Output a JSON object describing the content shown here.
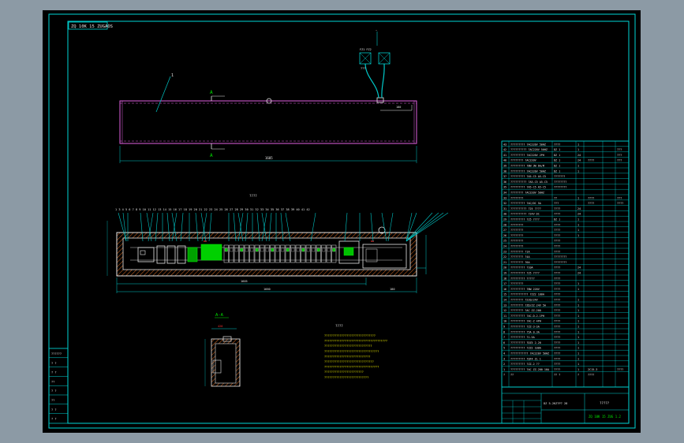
{
  "drawing": {
    "code_box": "ZQ 10K 15 ZUGAOS",
    "balloon_1": "1",
    "section_a_top": "A",
    "section_a_bottom": "A",
    "top_dim": "1605",
    "front_label": "????",
    "front_balloons": "1  3  4   5  6  7  8   9  10 11 12 13 14 15 16   17 18 19 20 21 22 23 24 25 26 27 28 29 30 31   32   33   34   35   36   37 38   39 40 41 42",
    "front_dim_main": "1605",
    "front_dim_total": "1660",
    "front_dim_right": "180",
    "section_title": "A-A",
    "section_dim": "420",
    "notes_title": "????",
    "notes_lines": [
      "??????????????????????????????",
      "?????????????????????????????????????",
      "????????????????????????????",
      "????????????????????????????????",
      "???????????????????????????",
      "?????????????????????????????",
      "????????????????????????????????",
      "???????????????????????",
      "??????????????????????????"
    ],
    "fan_labels": [
      "FZ1 FZ2",
      "???"
    ]
  },
  "left_strip": {
    "rows": [
      "??????",
      "? ?",
      "? ?",
      "??",
      "? ?",
      "??",
      "? ?",
      "? ?"
    ]
  },
  "bom": {
    "rows": [
      [
        "43",
        "????????? ?AC220V 50HZ",
        "????",
        "1",
        "",
        ""
      ],
      [
        "42",
        "?????????? ?AC220V 50HZ",
        "DZ 1",
        "1",
        "",
        "???"
      ],
      [
        "41",
        "????????? ?AC220V 2PH",
        "DZ 1",
        "24",
        "",
        "???"
      ],
      [
        "40",
        "???????? ?AC220V",
        "DZ 1",
        "24",
        "????",
        "???"
      ],
      [
        "39",
        "????????? ?BW 3W 6A/M",
        "DZ 1",
        "1",
        "",
        ""
      ],
      [
        "38",
        "????????? ?AC220V 50HZ",
        "DZ 1",
        "1",
        "",
        ""
      ],
      [
        "37",
        "????????? ?A5-C5 A5-C5",
        "???????",
        "",
        "",
        ""
      ],
      [
        "36",
        "?????????? ?A5-C5 A5-C5",
        "????????",
        "",
        "",
        ""
      ],
      [
        "35",
        "????????? ?A5-C5 A5-C5",
        "????????",
        "",
        "",
        ""
      ],
      [
        "34",
        "???????? ?AC220V 50HZ",
        "",
        "",
        "",
        ""
      ],
      [
        "33",
        "????????",
        "??",
        "1",
        "????",
        "???"
      ],
      [
        "32",
        "????????? ?AC/DC 5A",
        "???",
        "",
        "????",
        "????"
      ],
      [
        "31",
        "?????????? ?25 ????",
        "????",
        "24",
        "",
        ""
      ],
      [
        "30",
        "?????????? ?24V DC",
        "????",
        "24",
        "",
        ""
      ],
      [
        "29",
        "????????? ?25 ????",
        "DZ 1",
        "1",
        "",
        ""
      ],
      [
        "28",
        "????????",
        "????",
        "1",
        "",
        ""
      ],
      [
        "27",
        "????????",
        "????",
        "1",
        "",
        ""
      ],
      [
        "26",
        "????????",
        "????",
        "1",
        "",
        ""
      ],
      [
        "25",
        "????????",
        "????",
        "",
        "",
        ""
      ],
      [
        "24",
        "????????",
        "????",
        "",
        "",
        ""
      ],
      [
        "23",
        "???????? ?1A",
        "????",
        "",
        "",
        ""
      ],
      [
        "22",
        "???????? ?4A",
        "????????",
        "",
        "",
        ""
      ],
      [
        "21",
        "???????? ?6A",
        "????????",
        "",
        "",
        ""
      ],
      [
        "20",
        "????????? ?10A",
        "????",
        "24",
        "",
        ""
      ],
      [
        "19",
        "????????? ?25 ????",
        "????",
        "24",
        "",
        ""
      ],
      [
        "18",
        "????????? ?????",
        "????",
        "",
        "",
        ""
      ],
      [
        "17",
        "????????",
        "????",
        "1",
        "",
        ""
      ],
      [
        "16",
        "????????? ?BW 220V",
        "????",
        "1",
        "",
        ""
      ],
      [
        "15",
        "??????????? ?ZZ2 100A",
        "????",
        "",
        "",
        ""
      ],
      [
        "14",
        "???????? ?220/24V",
        "????",
        "1",
        "",
        ""
      ],
      [
        "13",
        "???????? ?ZD/ZZ 24V 5A",
        "????",
        "1",
        "",
        ""
      ],
      [
        "12",
        "???????? ?AC ZZ-200",
        "????",
        "1",
        "",
        ""
      ],
      [
        "11",
        "????????? ?AC-D-2-1PH",
        "????",
        "1",
        "",
        ""
      ],
      [
        "10",
        "????????? ?AC-Z 4PH",
        "????",
        "1",
        "",
        ""
      ],
      [
        "9",
        "????????? ?ZZ-3-SA",
        "????",
        "1",
        "",
        ""
      ],
      [
        "8",
        "????????? ?5A 0.3A",
        "????",
        "1",
        "",
        ""
      ],
      [
        "7",
        "????????? ?1.5A",
        "????",
        "1",
        "",
        ""
      ],
      [
        "6",
        "????????? ?DZ5 2-20",
        "????",
        "1",
        "",
        ""
      ],
      [
        "5",
        "????????? ?ZZ2 100A",
        "????",
        "1",
        "",
        ""
      ],
      [
        "4",
        "??????????? ?AC220V 50HZ",
        "????",
        "1",
        "",
        ""
      ],
      [
        "3",
        "????????? ?QF4 ZL 1",
        "????",
        "1",
        "",
        ""
      ],
      [
        "2",
        "????????? ?ZZ-2 ??",
        "????",
        "1",
        "",
        ""
      ],
      [
        "1",
        "????????? ?AC ZZ-200 10A",
        "????",
        "1",
        "2C15-3",
        "????"
      ]
    ],
    "header": [
      "?",
      "??",
      "?? ?",
      "?",
      "????",
      ""
    ],
    "tb_name": "DZ 5-2KZ?P? 28",
    "tb_title": "?????",
    "tb_code": "ZQ 10K 15 ZUG 1.2"
  },
  "colors": {
    "background": "#000000",
    "frame": "#00d6d6",
    "line": "#00c8c8",
    "green": "#00e600",
    "white": "#e6e6e6",
    "magenta": "#e060e0",
    "red": "#ff3030",
    "yellow": "#f0f000",
    "hatch": "#c06020"
  }
}
